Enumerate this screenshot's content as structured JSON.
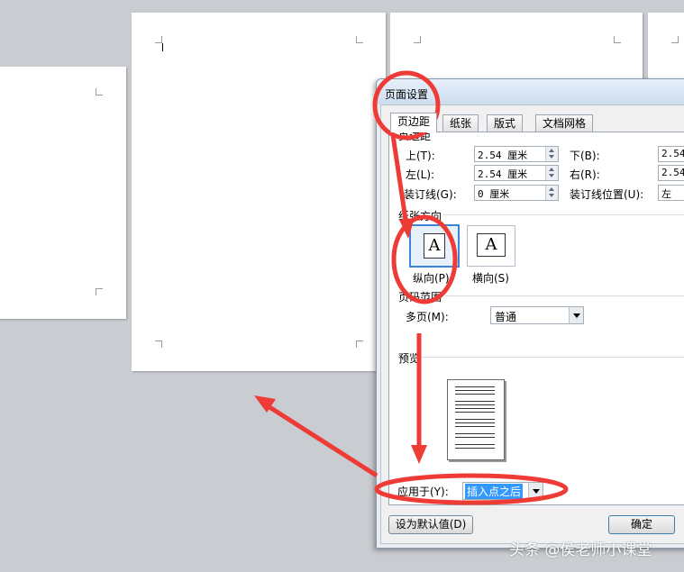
{
  "dialog": {
    "title": "页面设置",
    "tabs": [
      {
        "label": "页边距"
      },
      {
        "label": "纸张"
      },
      {
        "label": "版式"
      },
      {
        "label": "文档网格"
      }
    ],
    "margins": {
      "group_label": "页边距",
      "top_label": "上(T):",
      "top_value": "2.54 厘米",
      "bottom_label": "下(B):",
      "bottom_value": "2.54",
      "left_label": "左(L):",
      "left_value": "2.54 厘米",
      "right_label": "右(R):",
      "right_value": "2.54",
      "gutter_label": "装订线(G):",
      "gutter_value": "0 厘米",
      "gutter_pos_label": "装订线位置(U):",
      "gutter_pos_value": "左"
    },
    "orientation": {
      "group_label": "纸张方向",
      "portrait_label": "纵向(P)",
      "landscape_label": "横向(S)",
      "icon_letter": "A"
    },
    "pages": {
      "group_label": "页码范围",
      "multiple_label": "多页(M):",
      "multiple_value": "普通"
    },
    "preview": {
      "group_label": "预览"
    },
    "apply": {
      "label": "应用于(Y):",
      "value": "插入点之后"
    },
    "buttons": {
      "default_label": "设为默认值(D)",
      "ok_label": "确定"
    }
  },
  "watermark": "头条 @侯老师小课堂",
  "colors": {
    "annotation": "#ef3b36",
    "selection": "#3399ff",
    "workspace": "#c9ccd1"
  }
}
